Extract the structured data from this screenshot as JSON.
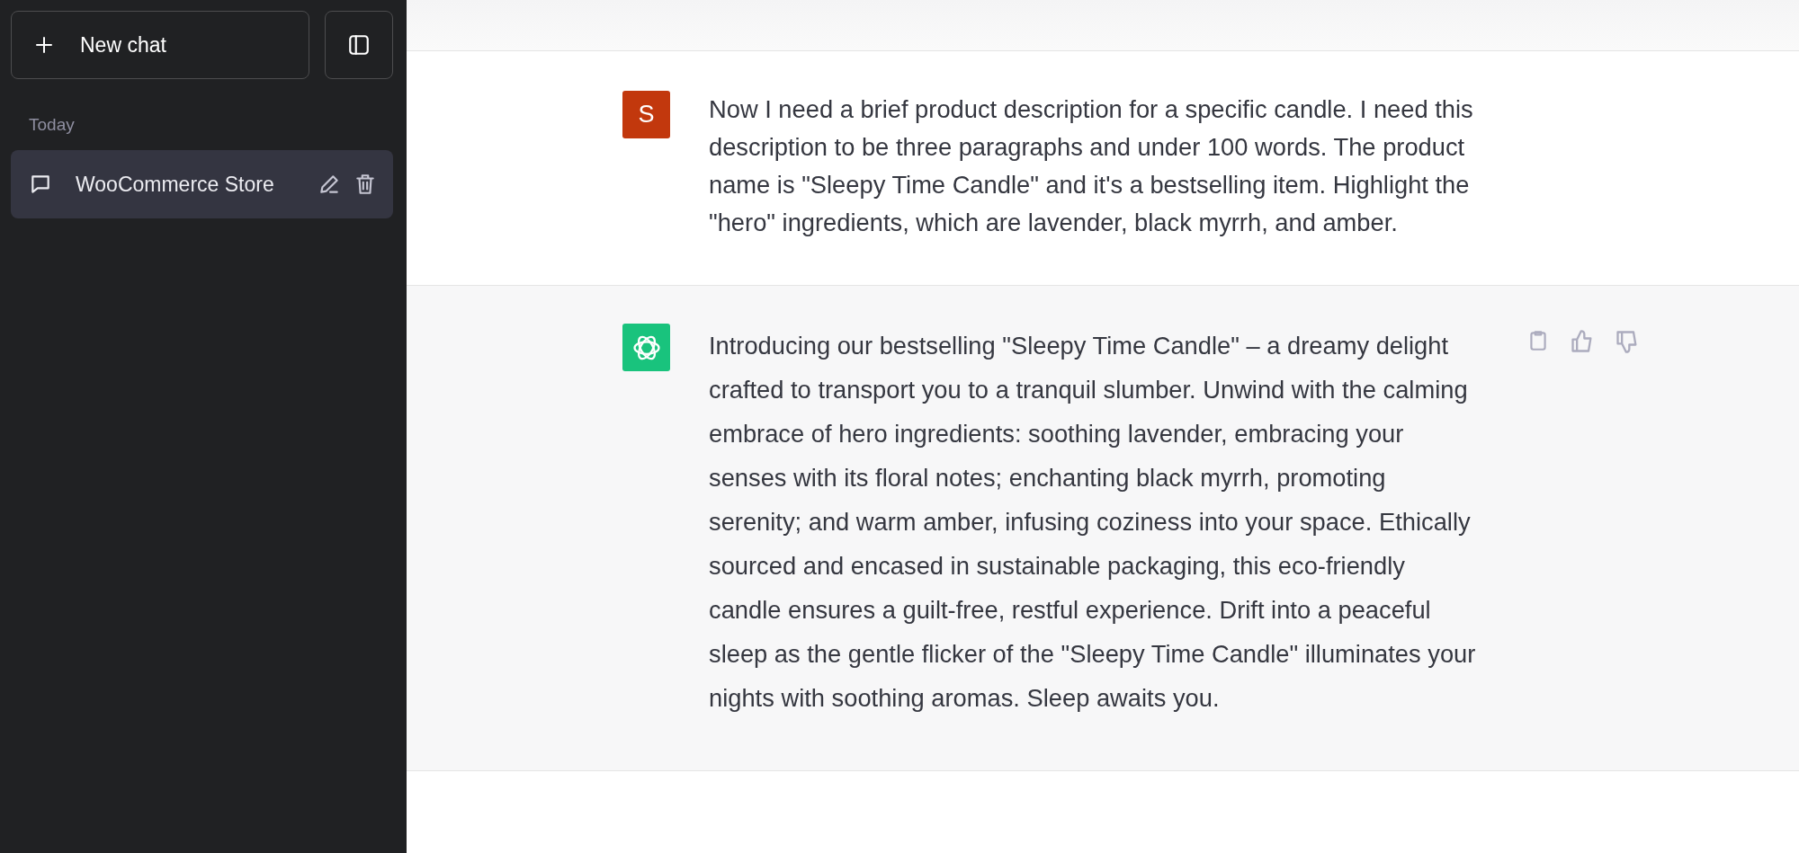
{
  "sidebar": {
    "new_chat_button": "New chat",
    "section_label": "Today",
    "conversations": [
      {
        "title": "WooCommerce Store",
        "selected": true
      }
    ]
  },
  "messages": [
    {
      "kind": "user",
      "avatar": "S",
      "text": "Now I need a brief product description for a specific candle. I need this description to be three paragraphs and under 100 words. The product name is \"Sleepy Time Candle\" and it's a bestselling item. Highlight the \"hero\" ingredients, which are lavender, black myrrh, and amber."
    },
    {
      "kind": "assistant",
      "text": "Introducing our bestselling \"Sleepy Time Candle\" – a dreamy delight crafted to transport you to a tranquil slumber. Unwind with the calming embrace of hero ingredients: soothing lavender, embracing your senses with its floral notes; enchanting black myrrh, promoting serenity; and warm amber, infusing coziness into your space. Ethically sourced and encased in sustainable packaging, this eco-friendly candle ensures a guilt-free, restful experience. Drift into a peaceful sleep as the gentle flicker of the \"Sleepy Time Candle\" illuminates your nights with soothing aromas. Sleep awaits you."
    }
  ]
}
